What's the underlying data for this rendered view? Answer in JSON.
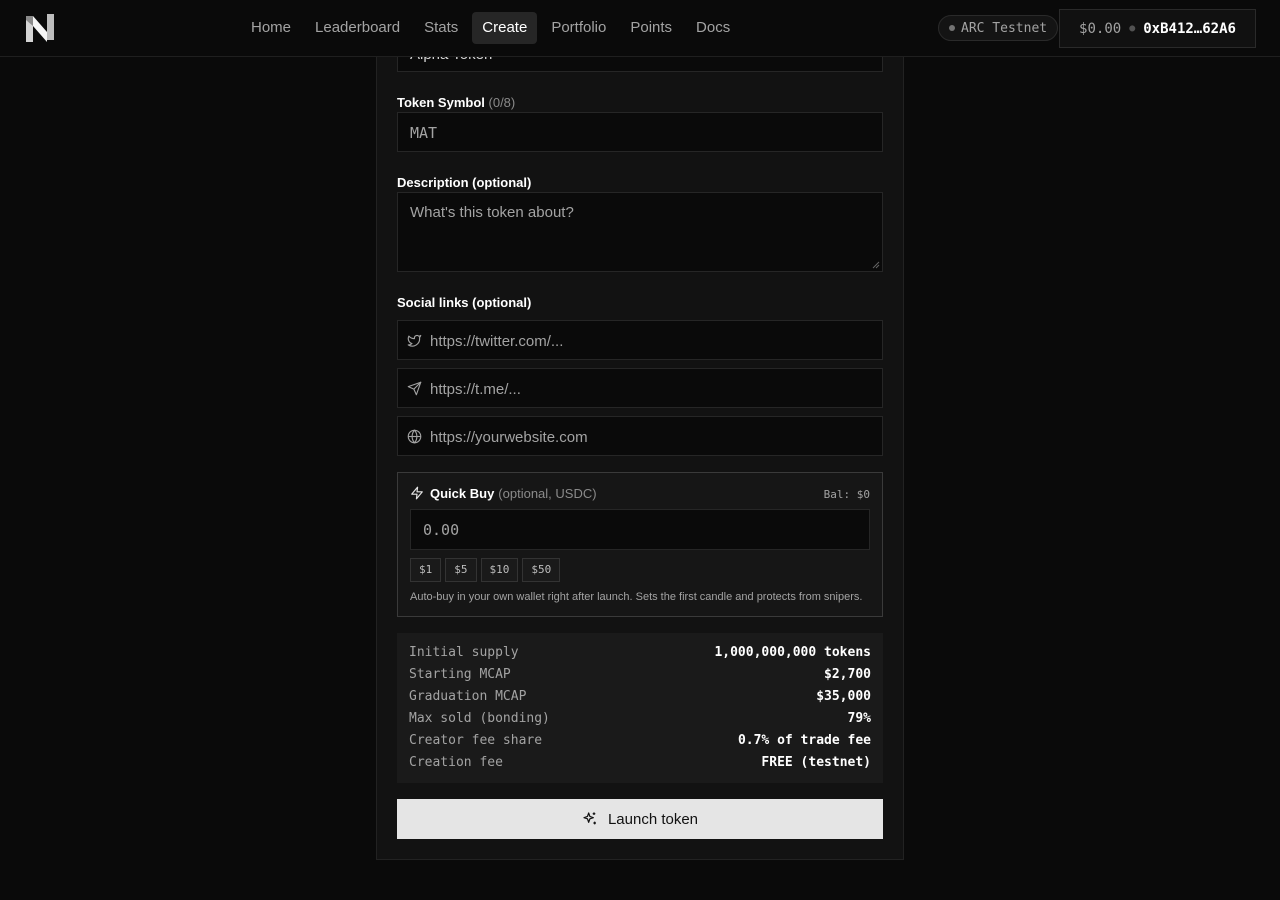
{
  "header": {
    "nav": [
      {
        "label": "Home",
        "active": false
      },
      {
        "label": "Leaderboard",
        "active": false
      },
      {
        "label": "Stats",
        "active": false
      },
      {
        "label": "Create",
        "active": true
      },
      {
        "label": "Portfolio",
        "active": false
      },
      {
        "label": "Points",
        "active": false
      },
      {
        "label": "Docs",
        "active": false
      }
    ],
    "network": "ARC Testnet",
    "wallet_balance": "$0.00",
    "wallet_address": "0xB412…62A6"
  },
  "form": {
    "name_value": "Alpha Token",
    "symbol_label": "Token Symbol",
    "symbol_count": "(0/8)",
    "symbol_placeholder": "MAT",
    "description_label": "Description (optional)",
    "description_placeholder": "What's this token about?",
    "social_label": "Social links (optional)",
    "twitter_placeholder": "https://twitter.com/...",
    "telegram_placeholder": "https://t.me/...",
    "website_placeholder": "https://yourwebsite.com"
  },
  "quick_buy": {
    "title": "Quick Buy",
    "subtitle": "(optional, USDC)",
    "balance": "Bal: $0",
    "placeholder": "0.00",
    "chips": [
      "$1",
      "$5",
      "$10",
      "$50"
    ],
    "note": "Auto-buy in your own wallet right after launch. Sets the first candle and protects from snipers."
  },
  "summary": [
    {
      "key": "Initial supply",
      "value": "1,000,000,000 tokens"
    },
    {
      "key": "Starting MCAP",
      "value": "$2,700"
    },
    {
      "key": "Graduation MCAP",
      "value": "$35,000"
    },
    {
      "key": "Max sold (bonding)",
      "value": "79%"
    },
    {
      "key": "Creator fee share",
      "value": "0.7% of trade fee"
    },
    {
      "key": "Creation fee",
      "value": "FREE (testnet)"
    }
  ],
  "launch_label": "Launch token"
}
